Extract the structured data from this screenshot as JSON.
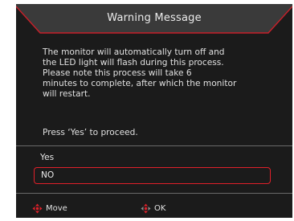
{
  "dialog": {
    "title": "Warning Message",
    "message": "The monitor will automatically turn off and\nthe LED light will flash during this process.\nPlease note this process will take 6\nminutes to complete, after which the monitor\nwill restart.",
    "prompt": "Press ‘Yes’ to proceed."
  },
  "options": {
    "yes_label": "Yes",
    "no_label": "NO",
    "selected": "NO"
  },
  "footer": {
    "move_label": "Move",
    "ok_label": "OK",
    "move_icon": "dpad-move-icon",
    "ok_icon": "dpad-ok-icon"
  },
  "colors": {
    "accent": "#e0202a",
    "background": "#1b1b1b",
    "text": "#e6e6e6"
  }
}
